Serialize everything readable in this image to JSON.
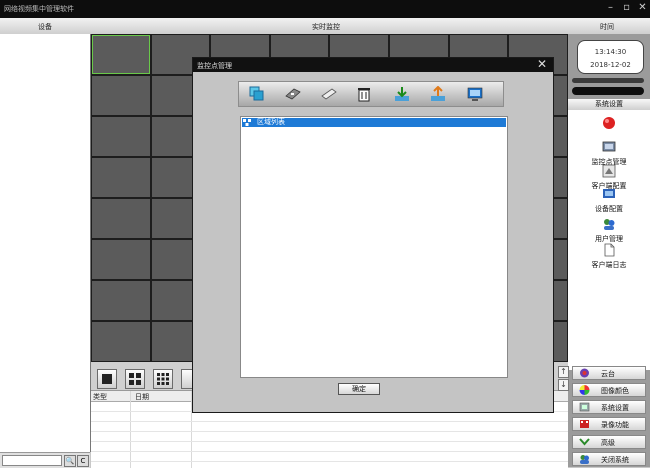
{
  "app": {
    "title": "网络视频集中管理软件"
  },
  "header": {
    "device_label": "设备",
    "live_label": "实时监控",
    "time_label": "时间"
  },
  "sidebar_left": {
    "search_buttons": [
      "🔍",
      "C"
    ]
  },
  "clock": {
    "time": "13:14:30",
    "date": "2018-12-02"
  },
  "right_panel": {
    "section_header": "系统设置",
    "menu": [
      {
        "icon": "record-button-icon",
        "label": ""
      },
      {
        "icon": "monitor-point-icon",
        "label": "监控点管理"
      },
      {
        "icon": "client-config-icon",
        "label": "客户端配置"
      },
      {
        "icon": "device-config-icon",
        "label": "设备配置"
      },
      {
        "icon": "users-icon",
        "label": "用户管理"
      },
      {
        "icon": "client-log-icon",
        "label": "客户端日志"
      }
    ],
    "bottom_buttons": [
      {
        "icon": "ptz-icon",
        "label": "云台"
      },
      {
        "icon": "color-wheel-icon",
        "label": "图像颜色"
      },
      {
        "icon": "settings-icon",
        "label": "系统设置"
      },
      {
        "icon": "film-icon",
        "label": "录像功能"
      },
      {
        "icon": "chevron-down-icon",
        "label": "高级"
      },
      {
        "icon": "users-icon",
        "label": "关闭系统"
      }
    ]
  },
  "log_table": {
    "columns": [
      "类型",
      "日期"
    ]
  },
  "dialog": {
    "title": "监控点管理",
    "close": "✕",
    "tree": [
      {
        "label": "区域列表",
        "selected": true
      }
    ],
    "confirm_label": "确定"
  },
  "colors": {
    "selected_cell_border": "#6ac94a",
    "selection_blue": "#1e7ad6"
  }
}
